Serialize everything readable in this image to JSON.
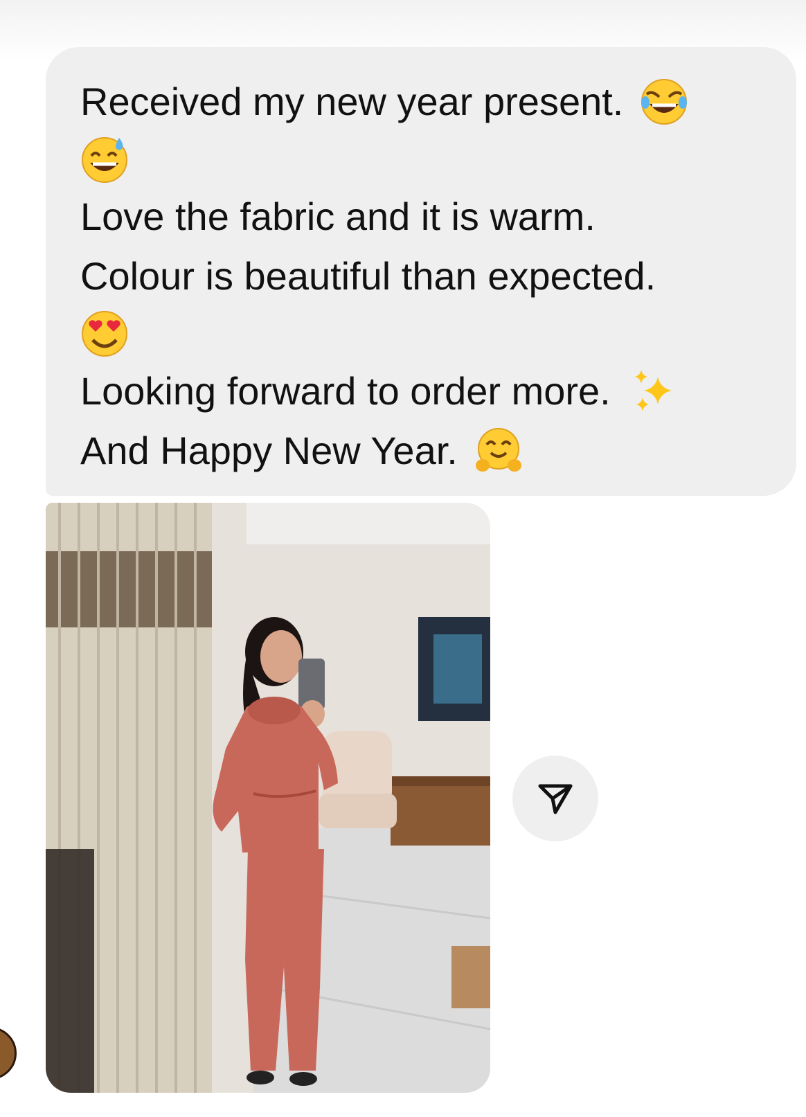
{
  "message": {
    "line1": "Received my new year present.",
    "line2": "Love the fabric and it is warm.",
    "line3": "Colour is beautiful than expected.",
    "line4": "Looking forward to order more.",
    "line5": "And Happy New Year.",
    "emojis": {
      "line1": "face-with-tears-of-joy-icon",
      "line1b": "grinning-face-with-sweat-icon",
      "line3b": "smiling-face-with-heart-eyes-icon",
      "line4": "sparkles-icon",
      "line5": "hugging-face-icon"
    }
  },
  "attachment": {
    "type": "photo",
    "subject": "person in a coral/rust two-piece tracksuit taking a mirror selfie"
  },
  "share_button": {
    "icon": "send-icon"
  },
  "colors": {
    "bubble": "#efefef",
    "text": "#111111",
    "tracksuit": "#c8685a"
  }
}
